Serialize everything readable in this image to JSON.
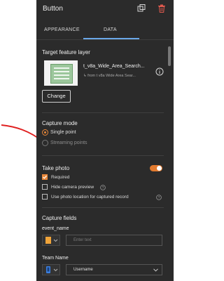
{
  "header": {
    "title": "Button",
    "copy_icon": "copy-icon",
    "delete_icon": "trash-icon"
  },
  "tabs": [
    {
      "label": "APPEARANCE",
      "selected": false
    },
    {
      "label": "DATA",
      "selected": true
    }
  ],
  "target_layer": {
    "section_label": "Target feature layer",
    "layer_name": "t_v8a_Wide_Area_Search...",
    "layer_source": "from t v8a Wide Area Sear...",
    "change_label": "Change"
  },
  "capture_mode": {
    "section_label": "Capture mode",
    "options": [
      {
        "label": "Single point",
        "selected": true
      },
      {
        "label": "Streaming points",
        "selected": false
      }
    ]
  },
  "take_photo": {
    "section_label": "Take photo",
    "enabled": true,
    "options": [
      {
        "label": "Required",
        "checked": true
      },
      {
        "label": "Hide camera preview",
        "checked": false
      },
      {
        "label": "Use photo location for captured record",
        "checked": false
      }
    ]
  },
  "capture_fields": {
    "section_label": "Capture fields",
    "fields": [
      {
        "name": "event_name",
        "placeholder": "Enter text",
        "value": ""
      },
      {
        "name": "Team Name",
        "placeholder": "",
        "value": "Username"
      }
    ]
  },
  "colors": {
    "panel_bg": "#2b2b2b",
    "accent_orange": "#e7873a",
    "tab_underline": "#6aa8e8",
    "arrow_red": "#e02020",
    "field_icon_orange": "#f0a43a",
    "field_icon_blue": "#3a7fe0"
  }
}
